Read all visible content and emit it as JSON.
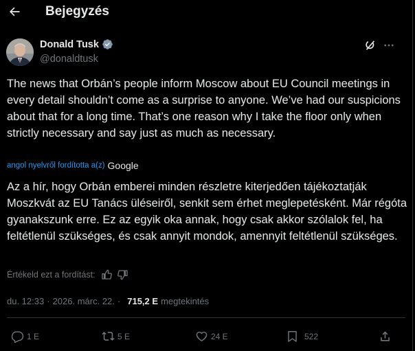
{
  "header": {
    "title": "Bejegyzés"
  },
  "author": {
    "name": "Donald Tusk",
    "handle": "@donaldtusk"
  },
  "post": {
    "text": "The news that Orbán’s people inform Moscow about EU Council meetings in every detail shouldn’t come as a surprise to anyone. We’ve had our suspicions about that for a long time. That’s one reason why I take the floor only when strictly necessary and say just as much as necessary.",
    "translated_by": "angol nyelvről fordította a(z)",
    "translator": "Google",
    "translated_text": "Az a hír, hogy Orbán emberei minden részletre kiterjedően tájékoztatják Moszkvát az EU Tanács üléseiről, senkit sem érhet meglepetésként. Már régóta gyanakszunk erre. Ez az egyik oka annak, hogy csak akkor szólalok fel, ha feltétlenül szükséges, és csak annyit mondok, amennyit feltétlenül szükséges.",
    "rate_label": "Értékeld ezt a fordítást:"
  },
  "meta": {
    "time": "du. 12:33",
    "date": "2026. márc. 22.",
    "separator": "·",
    "views": "715,2 E",
    "views_label": "megtekintés"
  },
  "actions": {
    "replies": "1 E",
    "reposts": "5 E",
    "likes": "24 E",
    "bookmarks": "522"
  },
  "colors": {
    "accent": "#1d9bf0",
    "muted": "#71767b",
    "text": "#e7e9ea",
    "background": "#000000"
  },
  "icons": [
    "back-arrow-icon",
    "verified-badge-icon",
    "grok-icon",
    "more-icon",
    "thumbs-up-icon",
    "thumbs-down-icon",
    "reply-icon",
    "repost-icon",
    "like-icon",
    "bookmark-icon",
    "share-icon"
  ]
}
